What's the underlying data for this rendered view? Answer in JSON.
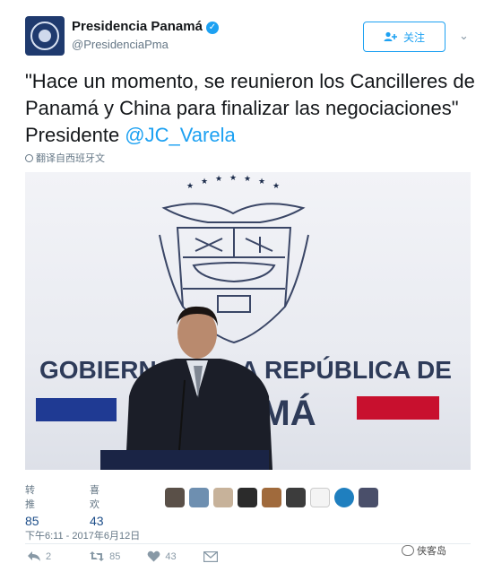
{
  "account": {
    "name": "Presidencia Panamá",
    "handle": "@PresidenciaPma",
    "verified_icon": "verified-badge-icon",
    "follow_label": "关注"
  },
  "tweet": {
    "text": "\"Hace un momento, se reunieron los Cancilleres de Panamá y China para finalizar las negociaciones\" Presidente ",
    "mention": "@JC_Varela",
    "translate_label": "翻译自西班牙文"
  },
  "photo": {
    "backdrop_line1": "GOBIERNO DE LA REPÚBLICA DE",
    "backdrop_line2": "PANAMÁ",
    "colors": {
      "red": "#c8102e",
      "blue": "#1f3a93"
    }
  },
  "stats": {
    "retweets_label": "转推",
    "retweets": "85",
    "likes_label": "喜欢",
    "likes": "43"
  },
  "timestamp": "下午6:11 - 2017年6月12日",
  "actions": {
    "reply_count": "2",
    "retweet_count": "85",
    "like_count": "43"
  },
  "watermark": "侠客岛"
}
